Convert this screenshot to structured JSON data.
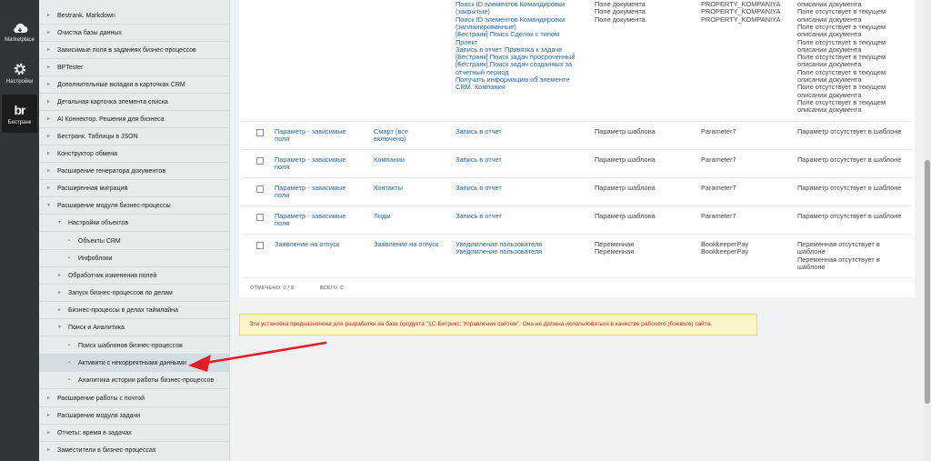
{
  "iconbar": {
    "items": [
      {
        "label": "Marketplace",
        "icon": "cloud-icon"
      },
      {
        "label": "Настройки",
        "icon": "gear-icon"
      },
      {
        "label": "Бестранк",
        "icon": "bestrank-logo",
        "logo": "br"
      }
    ]
  },
  "menu": {
    "items": [
      {
        "label": "Bestrank. Markdown"
      },
      {
        "label": "Очистка базы данных"
      },
      {
        "label": "Зависимые поля в заданиях бизнес-процессов"
      },
      {
        "label": "BPTester"
      },
      {
        "label": "Дополнительные вкладки в карточках CRM"
      },
      {
        "label": "Детальная карточка элемента списка"
      },
      {
        "label": "AI Коннектор. Решения для бизнеса"
      },
      {
        "label": "Бестранк. Таблицы в JSON"
      },
      {
        "label": "Конструктор обмена"
      },
      {
        "label": "Расширение генератора документов"
      },
      {
        "label": "Расширенная миграция"
      },
      {
        "label": "Расширение модуля бизнес-процессы"
      },
      {
        "label": "Настройки объектов"
      },
      {
        "label": "Объекты CRM"
      },
      {
        "label": "Инфоблоки"
      },
      {
        "label": "Обработчик изменения полей"
      },
      {
        "label": "Запуск бизнес-процессов по делам"
      },
      {
        "label": "Бизнес-процессы в делах таймлайна"
      },
      {
        "label": "Поиск и Аналитика"
      },
      {
        "label": "Поиск шаблонов бизнес-процессов"
      },
      {
        "label": "Активити с некорректными данными"
      },
      {
        "label": "Аналитика истории работы бизнес-процессов"
      },
      {
        "label": "Расширение работы с почтой"
      },
      {
        "label": "Расширение модуля задачи"
      },
      {
        "label": "Отчеты: время в задачах"
      },
      {
        "label": "Заместители в бизнес-процессах"
      }
    ]
  },
  "table": {
    "top": {
      "activities": [
        "Поиск ID элементов Командировки",
        "(закрытые)",
        "Поиск ID элементов Командировки",
        "(запланированные)",
        "[Бестранк] Поиск Сделок с типом",
        "Проект",
        "Запись в отчет. Привязка к задаче",
        "[Бестранк] Поиск задач просроченный",
        "[Бестранк] Поиск задач созданных за",
        "отчетный период",
        "Получить информацию об элементе",
        "CRM. Компания"
      ],
      "types": [
        "Поле документа",
        "Поле документа",
        "Поле документа"
      ],
      "codes": [
        "PROPERTY_KOMPANIYA",
        "PROPERTY_KOMPANIYA",
        "PROPERTY_KOMPANIYA"
      ],
      "errors": [
        "описании документа",
        "Поле отсутствует в текущем",
        "описании документа",
        "Поле отсутствует в текущем",
        "описании документа",
        "Поле отсутствует в текущем",
        "описании документа",
        "Поле отсутствует в текущем",
        "описании документа",
        "Поле отсутствует в текущем",
        "описании документа",
        "Поле отсутствует в текущем",
        "описании документа",
        "Поле отсутствует в текущем",
        "описании документа"
      ]
    },
    "rows": [
      {
        "template": [
          "Параметр - зависимые",
          "поля"
        ],
        "entity": [
          "Смарт (все",
          "включено)"
        ],
        "activity": [
          "Запись в отчет"
        ],
        "type": [
          "Параметр шаблона"
        ],
        "code": [
          "Parameter7"
        ],
        "error": [
          "Параметр отсутствует в шаблоне"
        ]
      },
      {
        "template": [
          "Параметр - зависимые",
          "поля"
        ],
        "entity": [
          "Компании"
        ],
        "activity": [
          "Запись в отчет"
        ],
        "type": [
          "Параметр шаблона"
        ],
        "code": [
          "Parameter7"
        ],
        "error": [
          "Параметр отсутствует в шаблоне"
        ]
      },
      {
        "template": [
          "Параметр - зависимые",
          "поля"
        ],
        "entity": [
          "Контакты"
        ],
        "activity": [
          "Запись в отчет"
        ],
        "type": [
          "Параметр шаблона"
        ],
        "code": [
          "Parameter7"
        ],
        "error": [
          "Параметр отсутствует в шаблоне"
        ]
      },
      {
        "template": [
          "Параметр - зависимые",
          "поля"
        ],
        "entity": [
          "Лиды"
        ],
        "activity": [
          "Запись в отчет"
        ],
        "type": [
          "Параметр шаблона"
        ],
        "code": [
          "Parameter7"
        ],
        "error": [
          "Параметр отсутствует в шаблоне"
        ]
      },
      {
        "template": [
          "Заявление на отпуск"
        ],
        "entity": [
          "Заявление на отпуск"
        ],
        "activity": [
          "Уведомление пользователя",
          "Уведомление пользователя"
        ],
        "type": [
          "Переменная",
          "Переменная"
        ],
        "code": [
          "BookkeeperPay",
          "BookkeeperPay"
        ],
        "error": [
          "Переменная отсутствует в",
          "шаблоне",
          "Переменная отсутствует в",
          "шаблоне"
        ]
      }
    ],
    "footer": {
      "marked": "ОТМЕЧЕНО: 0 / 8",
      "total": "ВСЕГО: 0"
    }
  },
  "warning": "Эта установка предназначена для разработки на базе продукта \"1С-Битрикс: Управление сайтом\". Она не должна использоваться в качестве рабочего (боевого) сайта.",
  "colors": {
    "link": "#2067b0",
    "warning_text": "#c12a2a",
    "warning_bg": "#fbf4c8",
    "annotation_arrow": "#e41e26"
  }
}
